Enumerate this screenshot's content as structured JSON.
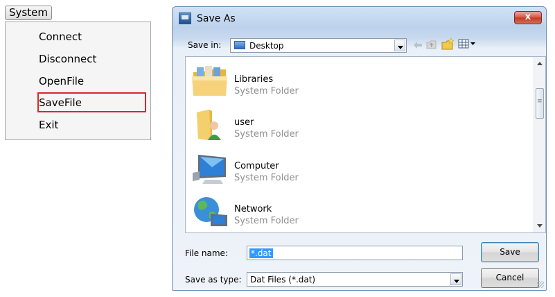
{
  "menu": {
    "button_label": "System",
    "items": [
      {
        "label": "Connect"
      },
      {
        "label": "Disconnect"
      },
      {
        "label": "OpenFile"
      },
      {
        "label": "SaveFile",
        "highlighted": true
      },
      {
        "label": "Exit"
      }
    ]
  },
  "dialog": {
    "title": "Save As",
    "close_label": "x",
    "save_in_label": "Save in:",
    "save_in_value": "Desktop",
    "items": [
      {
        "name": "Libraries",
        "type": "System Folder",
        "icon": "libraries-folder-icon"
      },
      {
        "name": "user",
        "type": "System Folder",
        "icon": "user-folder-icon"
      },
      {
        "name": "Computer",
        "type": "System Folder",
        "icon": "computer-icon"
      },
      {
        "name": "Network",
        "type": "System Folder",
        "icon": "network-icon"
      }
    ],
    "file_name_label": "File name:",
    "file_name_value": "*.dat",
    "save_as_type_label": "Save as type:",
    "save_as_type_value": "Dat Files (*.dat)",
    "save_button": "Save",
    "cancel_button": "Cancel"
  },
  "colors": {
    "highlight_border": "#d7272f",
    "close_button": "#c94a36",
    "selection": "#3399ff"
  }
}
